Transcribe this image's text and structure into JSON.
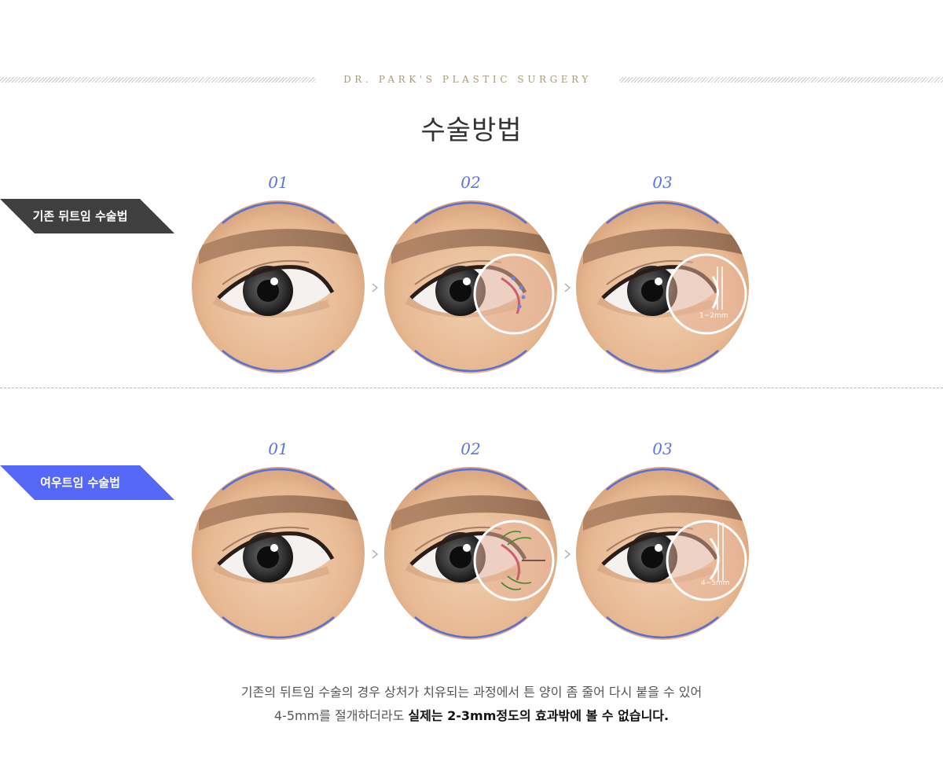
{
  "header": {
    "brand": "DR. PARK'S PLASTIC SURGERY",
    "title": "수술방법"
  },
  "sections": [
    {
      "label": "기존 뒤트임 수술법",
      "accent": "#3f3f3f",
      "steps": [
        {
          "num": "01"
        },
        {
          "num": "02"
        },
        {
          "num": "03",
          "measure": "1~2mm"
        }
      ]
    },
    {
      "label": "여우트임 수술법",
      "accent": "#5567f7",
      "steps": [
        {
          "num": "01"
        },
        {
          "num": "02"
        },
        {
          "num": "03",
          "measure": "4~5mm"
        }
      ]
    }
  ],
  "caption": {
    "line1": "기존의 뒤트임 수술의 경우 상처가 치유되는 과정에서 튼 양이 좀 줄어 다시 붙을 수 있어",
    "line2_normal": "4-5mm를 절개하더라도 ",
    "line2_strong": "실제는 2-3mm정도의 효과밖에 볼 수 없습니다."
  },
  "colors": {
    "step_number": "#5c73dc",
    "circle_ring": "#5a6fd0",
    "brand_text": "#a89a7e"
  }
}
